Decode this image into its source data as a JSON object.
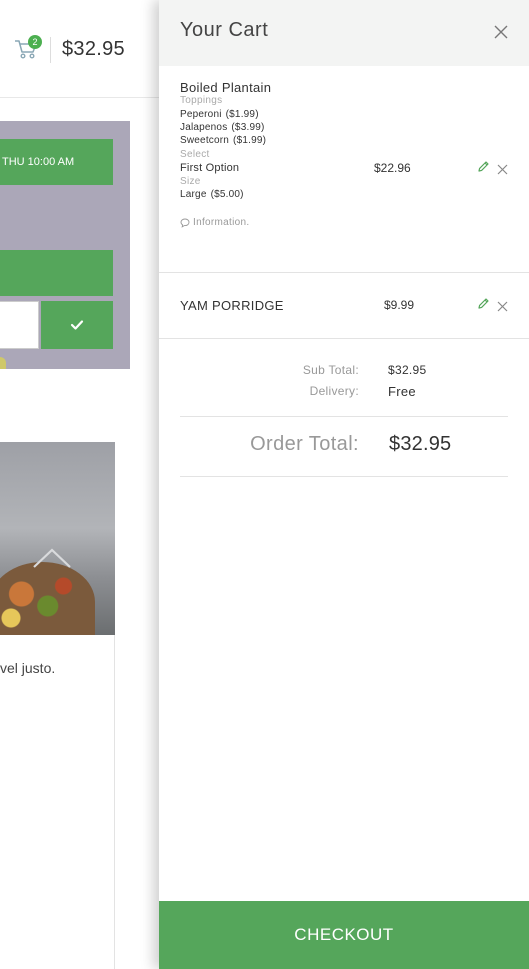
{
  "header": {
    "cart_count": "2",
    "cart_total": "$32.95"
  },
  "background": {
    "pickup_time": "THU 10:00 AM",
    "description_snippet": "vel justo."
  },
  "cart": {
    "title": "Your Cart",
    "items": [
      {
        "name": "Boiled Plantain",
        "price": "$22.96",
        "option_groups": [
          {
            "label": "Toppings",
            "options": [
              {
                "name": "Peperoni",
                "price": "($1.99)"
              },
              {
                "name": "Jalapenos",
                "price": "($3.99)"
              },
              {
                "name": "Sweetcorn",
                "price": "($1.99)"
              }
            ]
          },
          {
            "label": "Select",
            "options": [
              {
                "name": "First Option",
                "price": ""
              }
            ]
          },
          {
            "label": "Size",
            "options": [
              {
                "name": "Large",
                "price": "($5.00)"
              }
            ]
          }
        ],
        "info_label": "Information."
      },
      {
        "name": "YAM PORRIDGE",
        "price": "$9.99"
      }
    ],
    "subtotal_label": "Sub Total:",
    "subtotal_value": "$32.95",
    "delivery_label": "Delivery:",
    "delivery_value": "Free",
    "order_total_label": "Order Total:",
    "order_total_value": "$32.95",
    "checkout_label": "CHECKOUT"
  },
  "colors": {
    "accent": "#55a65b",
    "drawer_header_bg": "#f3f4f3"
  },
  "icons": {
    "cart": "cart-icon",
    "close": "close-icon",
    "edit": "pencil-icon",
    "remove": "close-icon",
    "info": "speech-bubble-icon",
    "confirm": "checkmark-icon",
    "scroll_up": "chevron-up-icon"
  }
}
